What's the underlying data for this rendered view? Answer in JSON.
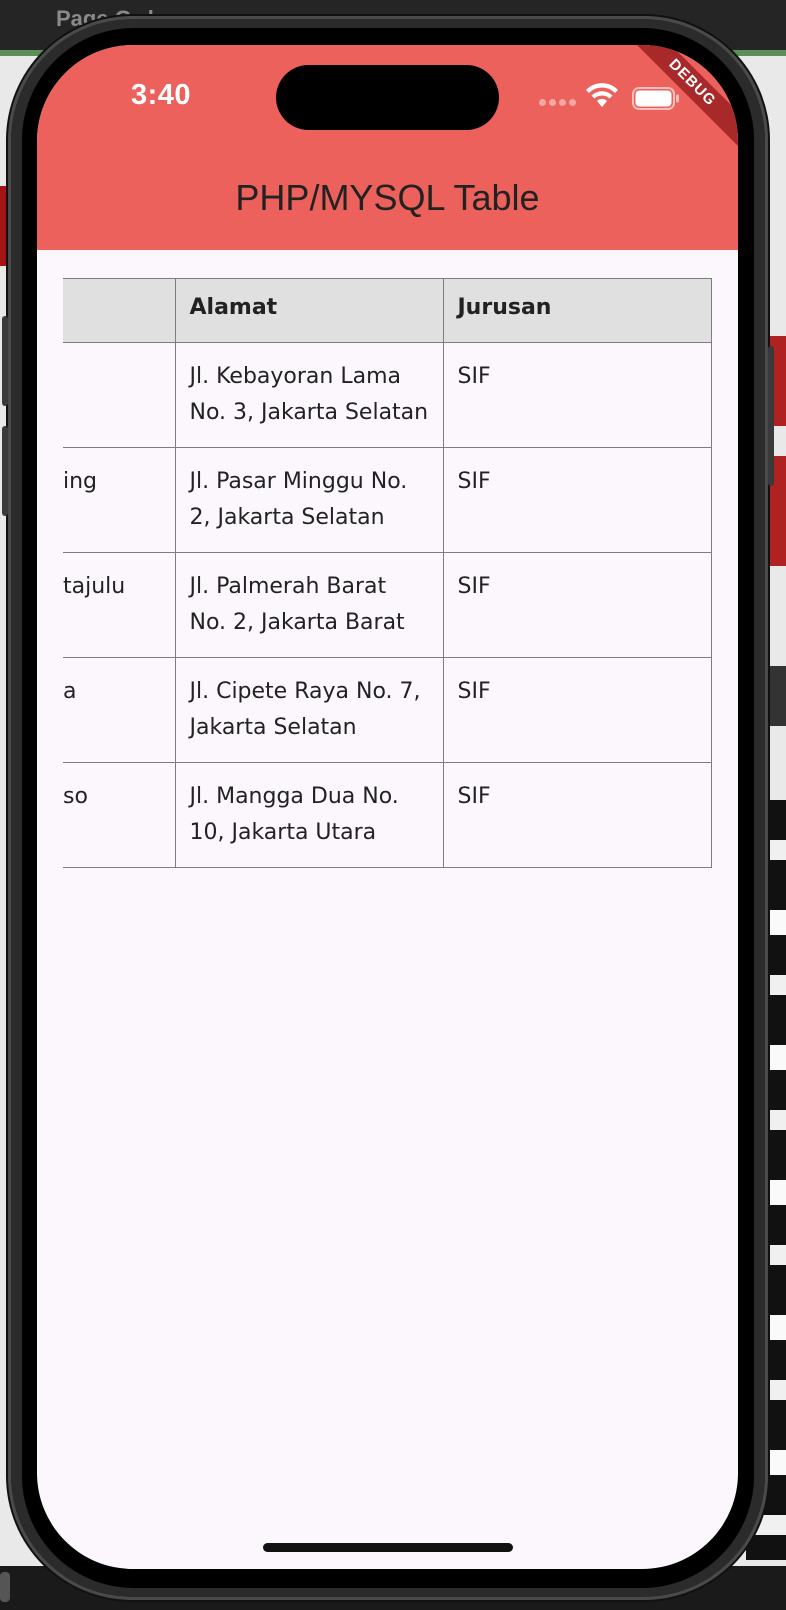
{
  "background": {
    "window_title": "Page Order"
  },
  "status_bar": {
    "time": "3:40",
    "icons": [
      "cellular-icon",
      "wifi-icon",
      "battery-icon"
    ],
    "debug_label": "DEBUG"
  },
  "appbar": {
    "title": "PHP/MYSQL Table",
    "color": "#ec615b"
  },
  "table": {
    "headers": [
      "",
      "Alamat",
      "Jurusan"
    ],
    "rows": [
      {
        "nama": "",
        "alamat": "Jl. Kebayoran Lama No. 3, Jakarta Selatan",
        "jurusan": "SIF"
      },
      {
        "nama": "ing",
        "alamat": "Jl. Pasar Minggu No. 2, Jakarta Selatan",
        "jurusan": "SIF"
      },
      {
        "nama": "tajulu",
        "alamat": "Jl. Palmerah Barat No. 2, Jakarta Barat",
        "jurusan": "SIF"
      },
      {
        "nama": "a",
        "alamat": "Jl. Cipete Raya No. 7, Jakarta Selatan",
        "jurusan": "SIF"
      },
      {
        "nama": "so",
        "alamat": "Jl. Mangga Dua No. 10, Jakarta Utara",
        "jurusan": "SIF"
      }
    ]
  }
}
